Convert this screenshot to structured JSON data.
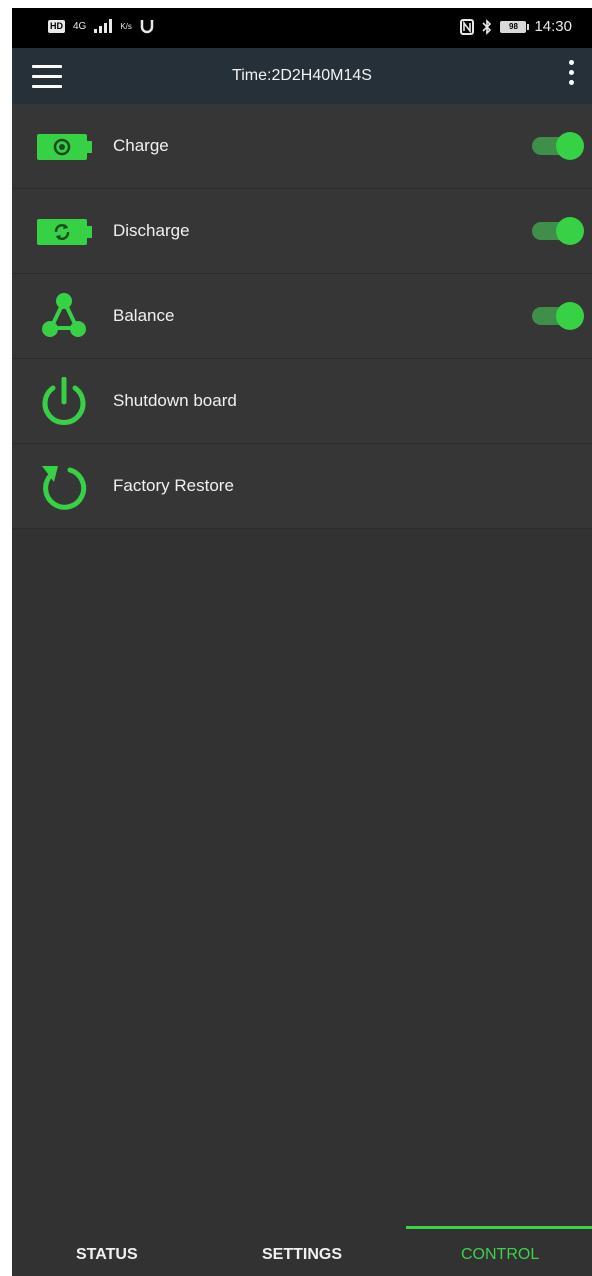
{
  "status_bar": {
    "left_badge": "HD",
    "network": "4G",
    "data_speed": "K/s",
    "battery": "98",
    "time": "14:30"
  },
  "appbar": {
    "title": "Time:2D2H40M14S",
    "menu_icon": "hamburger-menu-icon",
    "overflow_icon": "more-vert-icon"
  },
  "controls": [
    {
      "label": "Charge",
      "icon": "battery-charge-icon",
      "toggle": true,
      "enabled": true
    },
    {
      "label": "Discharge",
      "icon": "battery-discharge-icon",
      "toggle": true,
      "enabled": true
    },
    {
      "label": "Balance",
      "icon": "balance-network-icon",
      "toggle": true,
      "enabled": true
    },
    {
      "label": "Shutdown board",
      "icon": "power-icon",
      "toggle": false
    },
    {
      "label": "Factory Restore",
      "icon": "restore-icon",
      "toggle": false
    }
  ],
  "bottom_nav": {
    "tabs": [
      {
        "label": "STATUS",
        "active": false
      },
      {
        "label": "SETTINGS",
        "active": false
      },
      {
        "label": "CONTROL",
        "active": true
      }
    ]
  },
  "colors": {
    "accent": "#3bd24a",
    "toggle_track": "#3f8f4a",
    "appbar": "#263038",
    "background": "#323232",
    "row": "#363636"
  }
}
